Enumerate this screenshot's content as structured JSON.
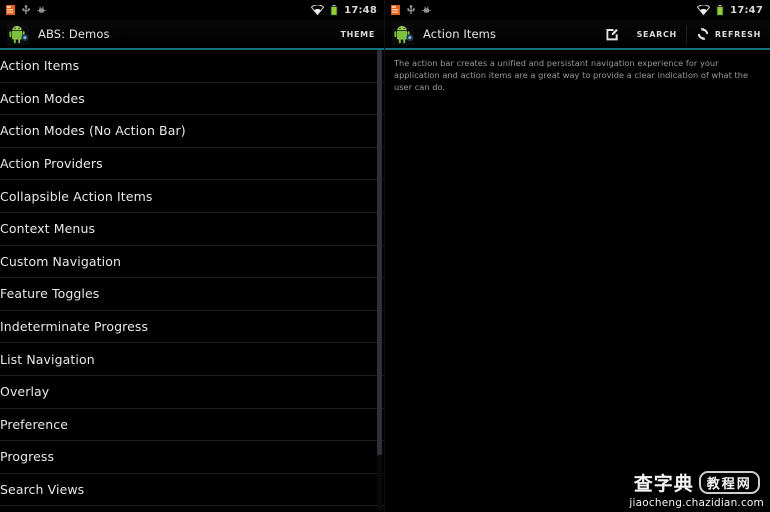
{
  "left_panel": {
    "statusbar": {
      "time": "17:48",
      "icons_left": [
        "notification-icon",
        "usb-icon",
        "debug-icon"
      ],
      "icons_right": [
        "wifi-icon",
        "battery-icon"
      ]
    },
    "actionbar": {
      "app_icon": "android-robot-icon",
      "title": "ABS: Demos",
      "theme_label": "THEME",
      "accent_color": "#15707f"
    },
    "list": {
      "items": [
        {
          "label": "Action Items"
        },
        {
          "label": "Action Modes"
        },
        {
          "label": "Action Modes (No Action Bar)"
        },
        {
          "label": "Action Providers"
        },
        {
          "label": "Collapsible Action Items"
        },
        {
          "label": "Context Menus"
        },
        {
          "label": "Custom Navigation"
        },
        {
          "label": "Feature Toggles"
        },
        {
          "label": "Indeterminate Progress"
        },
        {
          "label": "List Navigation"
        },
        {
          "label": "Overlay"
        },
        {
          "label": "Preference"
        },
        {
          "label": "Progress"
        },
        {
          "label": "Search Views"
        }
      ]
    }
  },
  "right_panel": {
    "statusbar": {
      "time": "17:47",
      "icons_left": [
        "notification-icon",
        "usb-icon",
        "debug-icon"
      ],
      "icons_right": [
        "wifi-icon",
        "battery-icon"
      ]
    },
    "actionbar": {
      "app_icon": "android-robot-icon",
      "title": "Action Items",
      "actions": [
        {
          "name": "compose-icon",
          "label": ""
        },
        {
          "name": "search-icon",
          "label": "SEARCH"
        },
        {
          "name": "refresh-icon",
          "label": "REFRESH"
        }
      ],
      "accent_color": "#15707f"
    },
    "content": {
      "description": "The action bar creates a unified and persistant navigation experience for your application and action items are a great way to provide a clear indication of what the user can do."
    }
  },
  "watermark": {
    "brand": "查字典",
    "badge": "教程网",
    "url": "jiaocheng.chazidian.com"
  }
}
